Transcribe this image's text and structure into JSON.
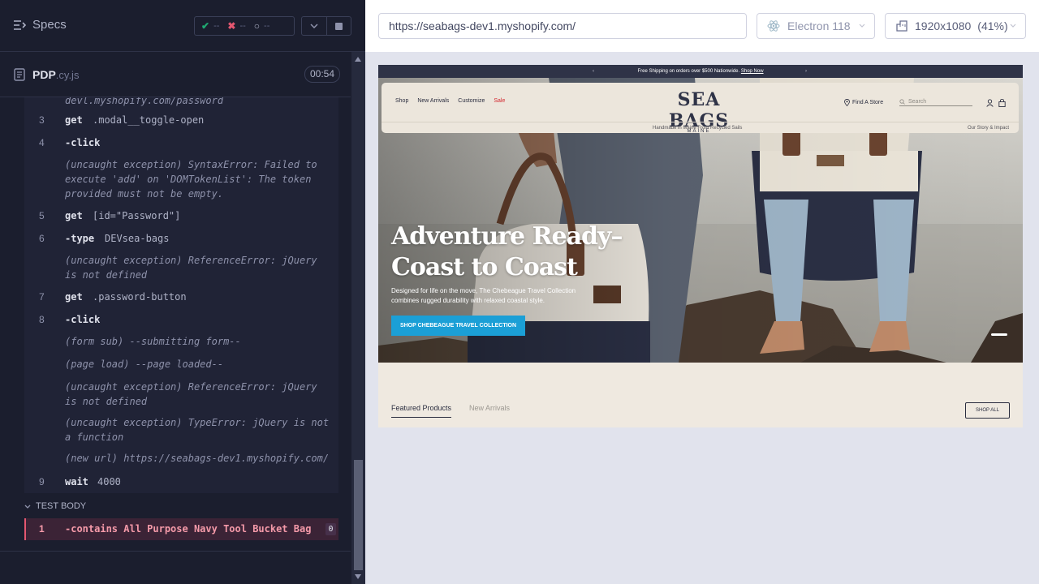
{
  "reporter": {
    "specs_label": "Specs",
    "stats": {
      "passed": "--",
      "failed": "--",
      "pending": "--"
    },
    "spec": {
      "name": "PDP",
      "ext": ".cy.js",
      "duration": "00:54"
    },
    "commands": [
      {
        "top_fragment": "devl.myshopify.com/password"
      },
      {
        "num": "3",
        "name": "get",
        "arg": ".modal__toggle-open"
      },
      {
        "num": "4",
        "name": "-click",
        "arg": ""
      },
      {
        "event": "(uncaught exception)  SyntaxError: Failed to execute 'add' on 'DOMTokenList': The token provided must not be empty."
      },
      {
        "num": "5",
        "name": "get",
        "arg": "[id=\"Password\"]"
      },
      {
        "num": "6",
        "name": "-type",
        "arg": "DEVsea-bags"
      },
      {
        "event": "(uncaught exception)  ReferenceError: jQuery is not defined"
      },
      {
        "num": "7",
        "name": "get",
        "arg": ".password-button"
      },
      {
        "num": "8",
        "name": "-click",
        "arg": ""
      },
      {
        "event": "(form sub)  --submitting form--"
      },
      {
        "event": "(page load)  --page loaded--"
      },
      {
        "event": "(uncaught exception)  ReferenceError: jQuery is not defined"
      },
      {
        "event": "(uncaught exception)  TypeError: jQuery is not a function"
      },
      {
        "event": "(new url)  https://seabags-dev1.myshopify.com/"
      },
      {
        "num": "9",
        "name": "wait",
        "arg": "4000"
      }
    ],
    "test_body_label": "TEST BODY",
    "body_cmd": {
      "num": "1",
      "name": "-contains  All Purpose Navy Tool Bucket Bag",
      "badge": "0"
    }
  },
  "aut": {
    "url": "https://seabags-dev1.myshopify.com/",
    "browser": "Electron 118",
    "viewport": "1920x1080",
    "scale": "(41%)"
  },
  "site": {
    "announcement": "Free Shipping on orders over $500 Nationwide.",
    "announcement_link": "Shop Now",
    "nav": [
      "Shop",
      "New Arrivals",
      "Customize",
      "Sale"
    ],
    "logo_main": "SEA BAGS",
    "logo_sub": "MAINE",
    "find_store": "Find A Store",
    "search_placeholder": "Search",
    "subbar_mid": "Handmade in Maine From Recycled Sails",
    "subbar_right": "Our Story & Impact",
    "hero_title_1": "Adventure Ready–",
    "hero_title_2": "Coast to Coast",
    "hero_desc": "Designed for life on the move, The Chebeague Travel Collection combines rugged durability with relaxed coastal style.",
    "hero_cta": "SHOP CHEBEAGUE TRAVEL COLLECTION",
    "tab_featured": "Featured Products",
    "tab_new": "New Arrivals",
    "shop_all": "SHOP ALL"
  },
  "colors": {
    "accent_cta": "#1b9fd6",
    "fail": "#e45770",
    "pass": "#1fa971",
    "sale": "#d3262e"
  }
}
